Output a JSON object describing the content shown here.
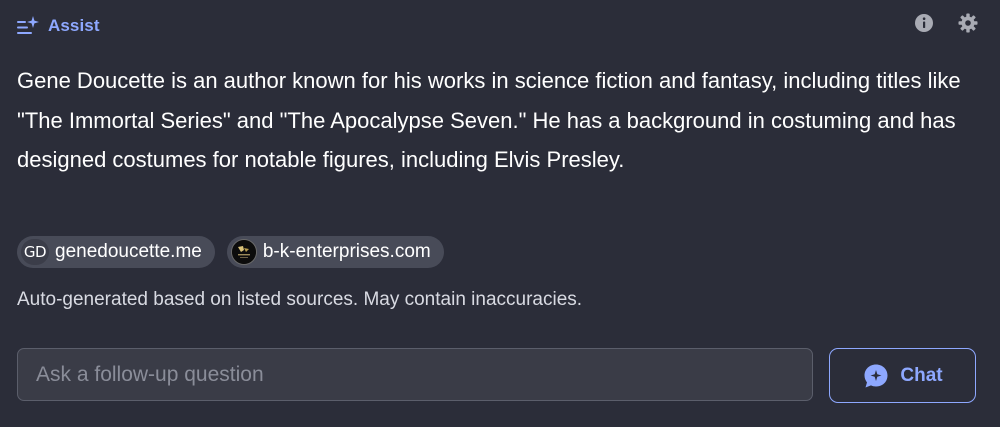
{
  "header": {
    "title": "Assist",
    "title_icon": "sparkle-list-icon",
    "actions": [
      {
        "icon": "info-icon"
      },
      {
        "icon": "gear-icon"
      }
    ]
  },
  "answer": {
    "text": "Gene Doucette is an author known for his works in science fiction and fantasy, including titles like \"The Immortal Series\" and \"The Apocalypse Seven.\" He has a background in costuming and has designed costumes for notable figures, including Elvis Presley."
  },
  "sources": [
    {
      "badge": "GD",
      "label": "genedoucette.me"
    },
    {
      "badge": "",
      "label": "b-k-enterprises.com"
    }
  ],
  "disclaimer": "Auto-generated based on listed sources. May contain inaccuracies.",
  "followup": {
    "placeholder": "Ask a follow-up question",
    "value": ""
  },
  "chat_button": {
    "label": "Chat",
    "icon": "chat-bubble-sparkle-icon"
  },
  "colors": {
    "background": "#2b2d39",
    "accent": "#8ea8ff",
    "chip": "#484b58",
    "input_bg": "#3a3c47",
    "muted_text": "#d8dae2",
    "icon_gray": "#a9abb4"
  }
}
